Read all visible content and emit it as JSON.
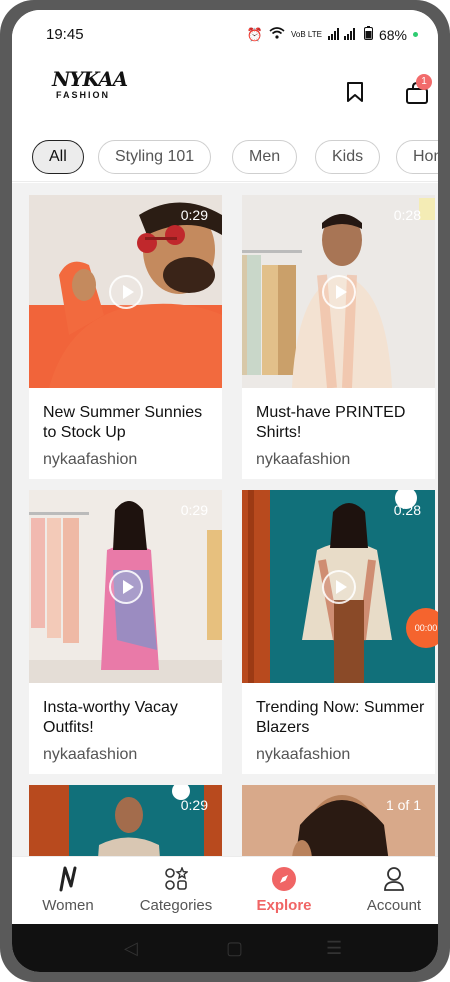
{
  "status_bar": {
    "time": "19:45",
    "network": "VoB LTE",
    "battery": "68%"
  },
  "header": {
    "logo_main": "NYKAA",
    "logo_sub": "FASHION",
    "bookmark_icon": "bookmark-icon",
    "bag_icon": "shopping-bag-icon",
    "bag_count": "1"
  },
  "chips": [
    {
      "label": "All",
      "active": true
    },
    {
      "label": "Styling 101"
    },
    {
      "label": "Men"
    },
    {
      "label": "Kids"
    },
    {
      "label": "Hom"
    }
  ],
  "feed": {
    "cards": [
      {
        "title": "New Summer Sunnies to Stock Up",
        "author": "nykaafashion",
        "duration": "0:29"
      },
      {
        "title": "Must-have PRINTED Shirts!",
        "author": "nykaafashion",
        "duration": "0:28"
      },
      {
        "title": "Insta-worthy Vacay Outfits!",
        "author": "nykaafashion",
        "duration": "0:29"
      },
      {
        "title": "Trending Now: Summer Blazers",
        "author": "nykaafashion",
        "duration": "0:28"
      },
      {
        "title": "",
        "author": "",
        "duration": "0:29"
      },
      {
        "title": "",
        "author": "",
        "duration": "1 of 1"
      }
    ],
    "floating_timer": "00:00"
  },
  "bottom_nav": [
    {
      "label": "Women",
      "icon": "nykaa-n-icon"
    },
    {
      "label": "Categories",
      "icon": "categories-icon"
    },
    {
      "label": "Explore",
      "icon": "compass-icon",
      "active": true
    },
    {
      "label": "Account",
      "icon": "user-icon"
    }
  ],
  "colors": {
    "accent": "#f06565",
    "badge": "#f26b6b",
    "timer": "#f5642e"
  }
}
